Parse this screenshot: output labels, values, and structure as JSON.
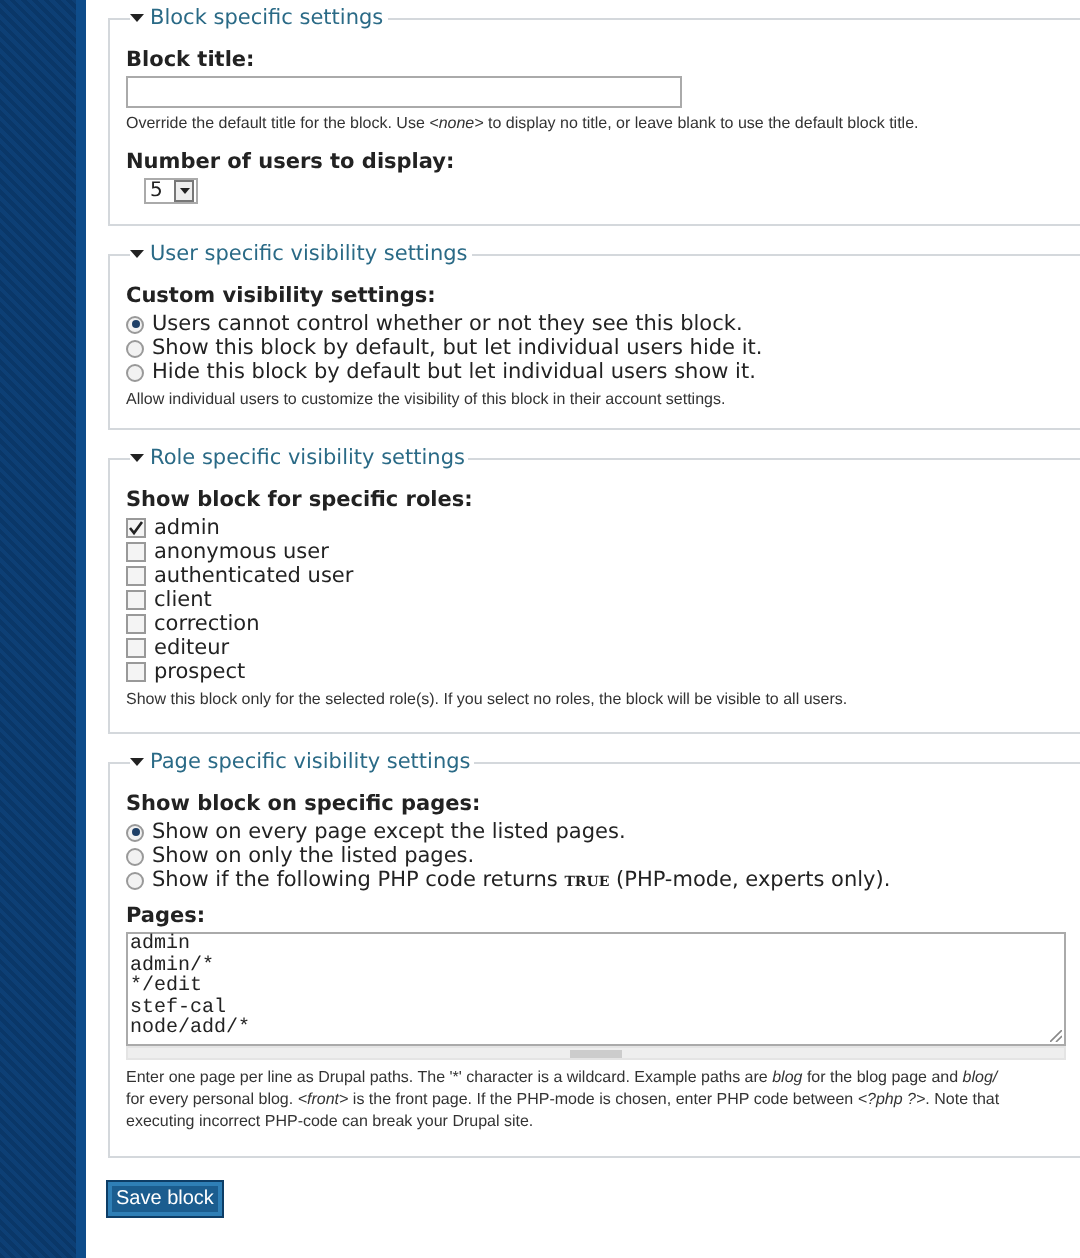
{
  "fieldsets": [
    {
      "kind": "block",
      "legend": "Block specific settings",
      "expanded": true,
      "title_field": {
        "label": "Block title:",
        "description": "Override the default title for the block. Use *<none>* to display no title, or leave blank to use the default block title."
      },
      "select": {
        "label": "Number of users to display:",
        "value": "5"
      }
    },
    {
      "kind": "radios",
      "legend": "User specific visibility settings",
      "expanded": true,
      "label": "Custom visibility settings:",
      "options": [
        {
          "label": "Users cannot control whether or not they see this block.",
          "selected": true
        },
        {
          "label": "Show this block by default, but let individual users hide it.",
          "selected": false
        },
        {
          "label": "Hide this block by default but let individual users show it.",
          "selected": false
        }
      ],
      "description": "Allow individual users to customize the visibility of this block in their account settings."
    },
    {
      "kind": "checkboxes",
      "legend": "Role specific visibility settings",
      "expanded": true,
      "label": "Show block for specific roles:",
      "options": [
        {
          "label": "admin",
          "checked": true
        },
        {
          "label": "anonymous user",
          "checked": false
        },
        {
          "label": "authenticated user",
          "checked": false
        },
        {
          "label": "client",
          "checked": false
        },
        {
          "label": "correction",
          "checked": false
        },
        {
          "label": "editeur",
          "checked": false
        },
        {
          "label": "prospect",
          "checked": false
        }
      ],
      "description": "Show this block only for the selected role(s). If you select no roles, the block will be visible to all users."
    },
    {
      "kind": "pages",
      "legend": "Page specific visibility settings",
      "expanded": true,
      "label": "Show block on specific pages:",
      "options": [
        {
          "label": "Show on every page except the listed pages.",
          "selected": true
        },
        {
          "label": "Show on only the listed pages.",
          "selected": false
        },
        {
          "label": "Show if the following PHP code returns **TRUE** (PHP-mode, experts only).",
          "selected": false
        }
      ],
      "pages": {
        "label": "Pages:",
        "lines": [
          "admin",
          "admin/*",
          "*/edit",
          "stef-cal",
          "node/add/*"
        ],
        "description_lines": [
          "Enter one page per line as Drupal paths. The '*' character is a wildcard. Example paths are *blog* for the blog page and *blog/*",
          "for every personal blog. *<front>* is the front page. If the PHP-mode is chosen, enter PHP code between *<?php ?>*. Note that",
          "executing incorrect PHP-code can break your Drupal site."
        ]
      }
    }
  ],
  "submit": "Save block"
}
